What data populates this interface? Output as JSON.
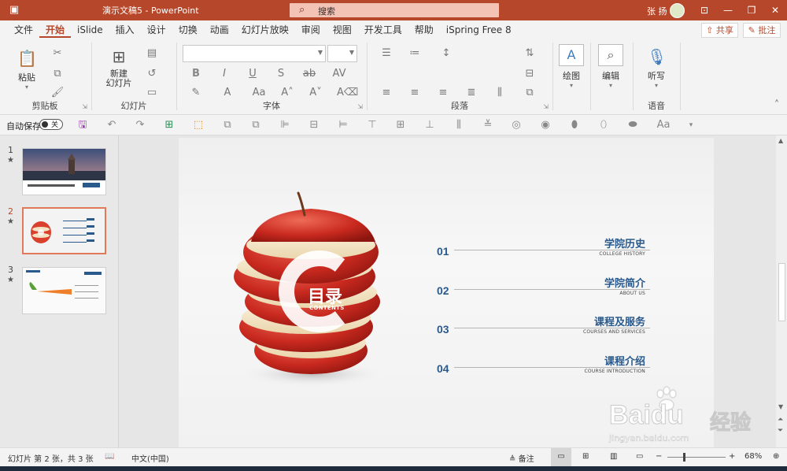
{
  "title_bar": {
    "title": "演示文稿5  -  PowerPoint",
    "search_placeholder": "搜索",
    "user_name": "张 扬"
  },
  "menu": {
    "tabs": [
      "文件",
      "开始",
      "iSlide",
      "插入",
      "设计",
      "切换",
      "动画",
      "幻灯片放映",
      "审阅",
      "视图",
      "开发工具",
      "帮助",
      "iSpring Free 8"
    ],
    "active_tab": "开始",
    "share_label": "共享",
    "comment_label": "批注"
  },
  "ribbon": {
    "paste_label": "粘贴",
    "clipboard_label": "剪贴板",
    "new_slide_label": "新建\n幻灯片",
    "slides_label": "幻灯片",
    "font_label": "字体",
    "paragraph_label": "段落",
    "draw_label": "绘图",
    "edit_label": "编辑",
    "listen_label": "听写",
    "voice_label": "语音"
  },
  "quick_access": {
    "autosave_label": "自动保存",
    "autosave_state": "关"
  },
  "thumbnails": [
    {
      "number": "1",
      "star": "★",
      "caption": "瑞士卢塞恩城市风景介绍"
    },
    {
      "number": "2",
      "star": "★",
      "selected": true
    },
    {
      "number": "3",
      "star": "★",
      "caption": "胡萝卜介绍"
    }
  ],
  "slide": {
    "center_title": "目录",
    "center_sub": "CONTENTS",
    "items": [
      {
        "num": "01",
        "title": "学院历史",
        "sub": "COLLEGE HISTORY"
      },
      {
        "num": "02",
        "title": "学院简介",
        "sub": "ABOUT US"
      },
      {
        "num": "03",
        "title": "课程及服务",
        "sub": "COURSES AND SERVICES"
      },
      {
        "num": "04",
        "title": "课程介绍",
        "sub": "COURSE INTRODUCTION"
      }
    ]
  },
  "status_bar": {
    "slide_info": "幻灯片 第 2 张，共 3 张",
    "language": "中文(中国)",
    "notes_label": "备注",
    "zoom": "68%"
  },
  "watermark": {
    "brand": "Bai",
    "brand2": "du",
    "cn": "经验",
    "url": "jingyan.baidu.com"
  },
  "colors": {
    "accent": "#b7472a",
    "toc_blue": "#2a5a8c"
  }
}
